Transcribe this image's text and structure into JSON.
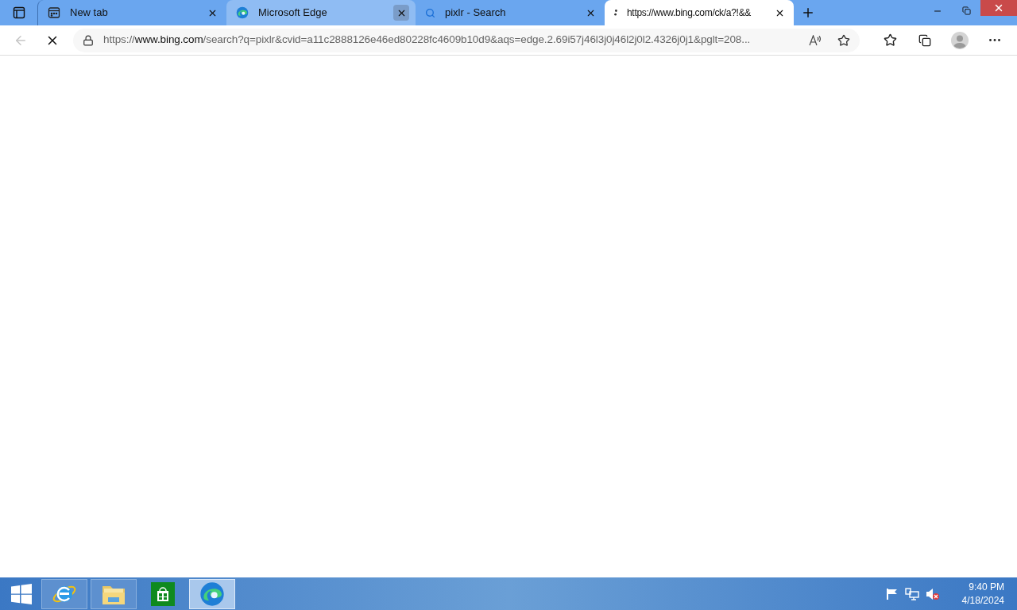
{
  "tabs": [
    {
      "kind": "newtab",
      "title": "New tab",
      "selected": false,
      "hovered": false
    },
    {
      "kind": "edge",
      "title": "Microsoft Edge",
      "selected": false,
      "hovered": true
    },
    {
      "kind": "search",
      "title": "pixlr - Search",
      "selected": false,
      "hovered": false
    },
    {
      "kind": "loading",
      "title": "https://www.bing.com/ck/a?!&&",
      "selected": true,
      "hovered": false
    }
  ],
  "address": {
    "scheme": "https://",
    "domain": "www.bing.com",
    "rest": "/search?q=pixlr&cvid=a11c2888126e46ed80228fc4609b10d9&aqs=edge.2.69i57j46l3j0j46l2j0l2.4326j0j1&pglt=208..."
  },
  "loading": true,
  "taskbar": {
    "items": [
      {
        "kind": "ie",
        "selected": false
      },
      {
        "kind": "explorer",
        "selected": false
      },
      {
        "kind": "store",
        "selected": false
      },
      {
        "kind": "edge",
        "selected": true
      }
    ],
    "time": "9:40 PM",
    "date": "4/18/2024"
  }
}
